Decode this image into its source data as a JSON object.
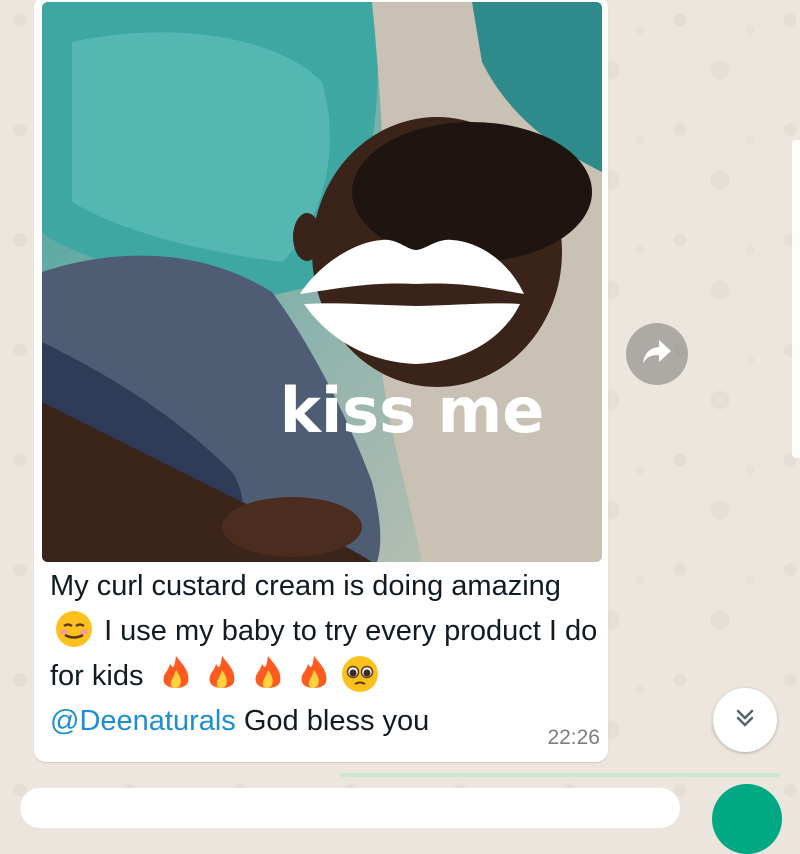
{
  "message": {
    "image_overlay_text": "kiss me",
    "caption_segments": [
      "My curl custard cream is doing amazing",
      "I use my baby to try every product I do for kids",
      "@Deenaturals",
      "God bless you"
    ],
    "time": "22:26"
  },
  "colors": {
    "accent": "#00a884",
    "mention": "#1b8fd1",
    "bubble": "#ffffff",
    "wallpaper": "#ece5dd"
  },
  "icons": {
    "forward": "forward-arrow-icon",
    "scroll_down": "double-chevron-down-icon",
    "emoji_smile": "smiling-face-emoji",
    "emoji_fire": "fire-emoji",
    "emoji_pleading": "pleading-face-emoji"
  }
}
